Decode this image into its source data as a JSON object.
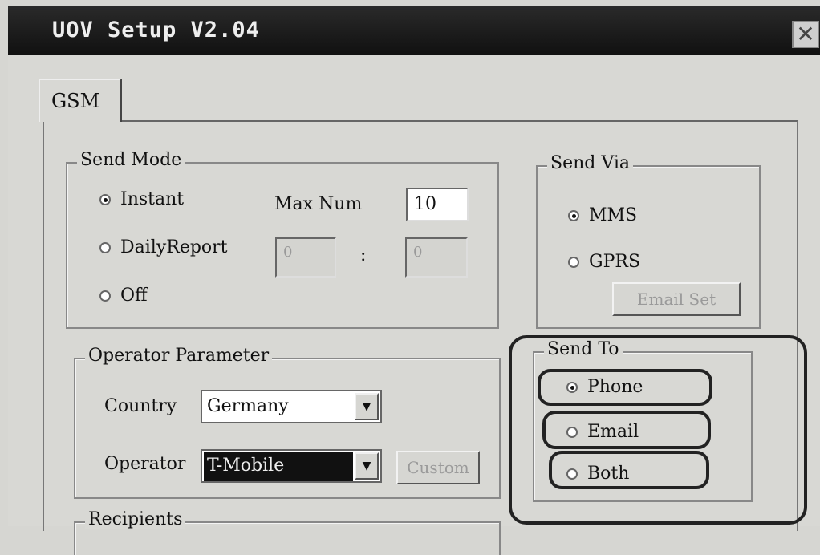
{
  "window": {
    "title": "UOV Setup V2.04",
    "close_glyph": "✕"
  },
  "tabs": [
    {
      "label": "GSM"
    }
  ],
  "send_mode": {
    "legend": "Send Mode",
    "options": [
      {
        "label": "Instant",
        "selected": true
      },
      {
        "label": "DailyReport",
        "selected": false
      },
      {
        "label": "Off",
        "selected": false
      }
    ],
    "max_num_label": "Max Num",
    "max_num_value": "10",
    "daily_hour": "0",
    "daily_separator": ":",
    "daily_minute": "0"
  },
  "send_via": {
    "legend": "Send Via",
    "options": [
      {
        "label": "MMS",
        "selected": true
      },
      {
        "label": "GPRS",
        "selected": false
      }
    ],
    "email_set_label": "Email Set"
  },
  "operator_parameter": {
    "legend": "Operator Parameter",
    "country_label": "Country",
    "country_value": "Germany",
    "operator_label": "Operator",
    "operator_value": "T-Mobile",
    "custom_label": "Custom"
  },
  "send_to": {
    "legend": "Send To",
    "options": [
      {
        "label": "Phone",
        "selected": true
      },
      {
        "label": "Email",
        "selected": false
      },
      {
        "label": "Both",
        "selected": false
      }
    ]
  },
  "recipients": {
    "legend": "Recipients"
  }
}
